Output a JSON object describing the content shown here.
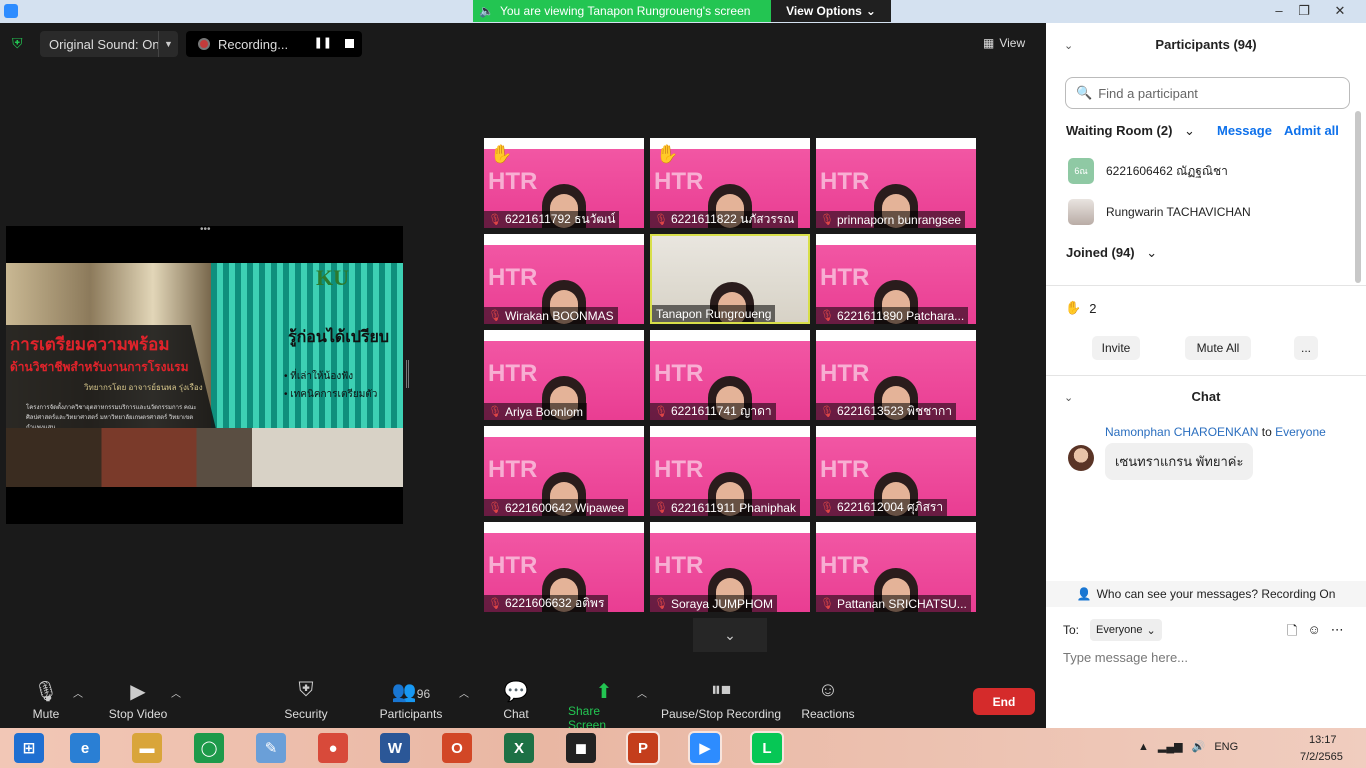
{
  "titlebar": {
    "banner": "You are viewing Tanapon Rungroueng's screen",
    "view_options": "View Options",
    "controls": [
      "–",
      "❐",
      "✕"
    ]
  },
  "meeting_top": {
    "original_sound": "Original Sound: On",
    "recording": "Recording...",
    "view": "View"
  },
  "slide": {
    "title1": "การเตรียมความพร้อม",
    "title2": "ด้านวิชาชีพสำหรับงานการโรงแรม",
    "by": "วิทยากรโดย อาจารย์ธนพล รุ่งเรือง",
    "small": "โครงการจัดตั้งภาควิชาอุตสาหกรรมบริการและนวัตกรรมการ คณะศิลปศาสตร์และวิทยาศาสตร์ มหาวิทยาลัยเกษตรศาสตร์ วิทยาเขตกำแพงแสน",
    "logo": "KU",
    "right_title": "รู้ก่อนได้เปรียบ",
    "bullets": [
      "• ที่เล่าให้น้องฟัง",
      "• เทคนิคการเตรียมตัว"
    ]
  },
  "tiles": [
    {
      "name": "6221611792 ธนวัฒน์",
      "hand": true
    },
    {
      "name": "6221611822 นภัสวรรณ",
      "hand": true
    },
    {
      "name": "prinnaporn bunrangsee",
      "hand": false
    },
    {
      "name": "Wirakan BOONMAS",
      "hand": false
    },
    {
      "name": "Tanapon Rungroueng",
      "hand": false,
      "active": true
    },
    {
      "name": "6221611890 Patchara...",
      "hand": false
    },
    {
      "name": "Ariya Boonlom",
      "hand": false
    },
    {
      "name": "6221611741 ญาดา",
      "hand": false
    },
    {
      "name": "6221613523 พิชชากา",
      "hand": false
    },
    {
      "name": "6221600642 Wipawee",
      "hand": false
    },
    {
      "name": "6221611911 Phaniphak",
      "hand": false
    },
    {
      "name": "6221612004 ศุภิสรา",
      "hand": false
    },
    {
      "name": "6221606632 อติพร",
      "hand": false
    },
    {
      "name": "Soraya JUMPHOM",
      "hand": false
    },
    {
      "name": "Pattanan SRICHATSU...",
      "hand": false
    }
  ],
  "toolbar": {
    "mute": "Mute",
    "stop_video": "Stop Video",
    "security": "Security",
    "participants": "Participants",
    "participants_count": "96",
    "chat": "Chat",
    "share_screen": "Share Screen",
    "pause_stop": "Pause/Stop Recording",
    "reactions": "Reactions",
    "end": "End"
  },
  "sidebar": {
    "participants_title": "Participants (94)",
    "search_placeholder": "Find a participant",
    "waiting_room": "Waiting Room (2)",
    "message": "Message",
    "admit_all": "Admit all",
    "waiting": [
      {
        "avatar_text": "6ณ",
        "name": "6221606462 ณัฏฐณิชา"
      },
      {
        "avatar_text": "",
        "name": "Rungwarin TACHAVICHAN"
      }
    ],
    "joined": "Joined (94)",
    "raised_count": "2",
    "invite": "Invite",
    "mute_all": "Mute All",
    "more": "...",
    "chat_title": "Chat",
    "chat_sender": "Namonphan CHAROENKAN",
    "chat_to_word": "to",
    "chat_to": "Everyone",
    "chat_message": "เซนทราแกรน พัทยาค่ะ",
    "who_can_see": "Who can see your messages? Recording On",
    "to_label": "To:",
    "to_value": "Everyone",
    "input_placeholder": "Type message here..."
  },
  "taskbar": {
    "apps": [
      "start",
      "internet-explorer",
      "file-explorer",
      "app",
      "paint",
      "chrome",
      "word",
      "office",
      "excel",
      "webex",
      "powerpoint",
      "zoom",
      "line"
    ],
    "lang": "ENG",
    "time": "13:17",
    "date": "7/2/2565"
  }
}
